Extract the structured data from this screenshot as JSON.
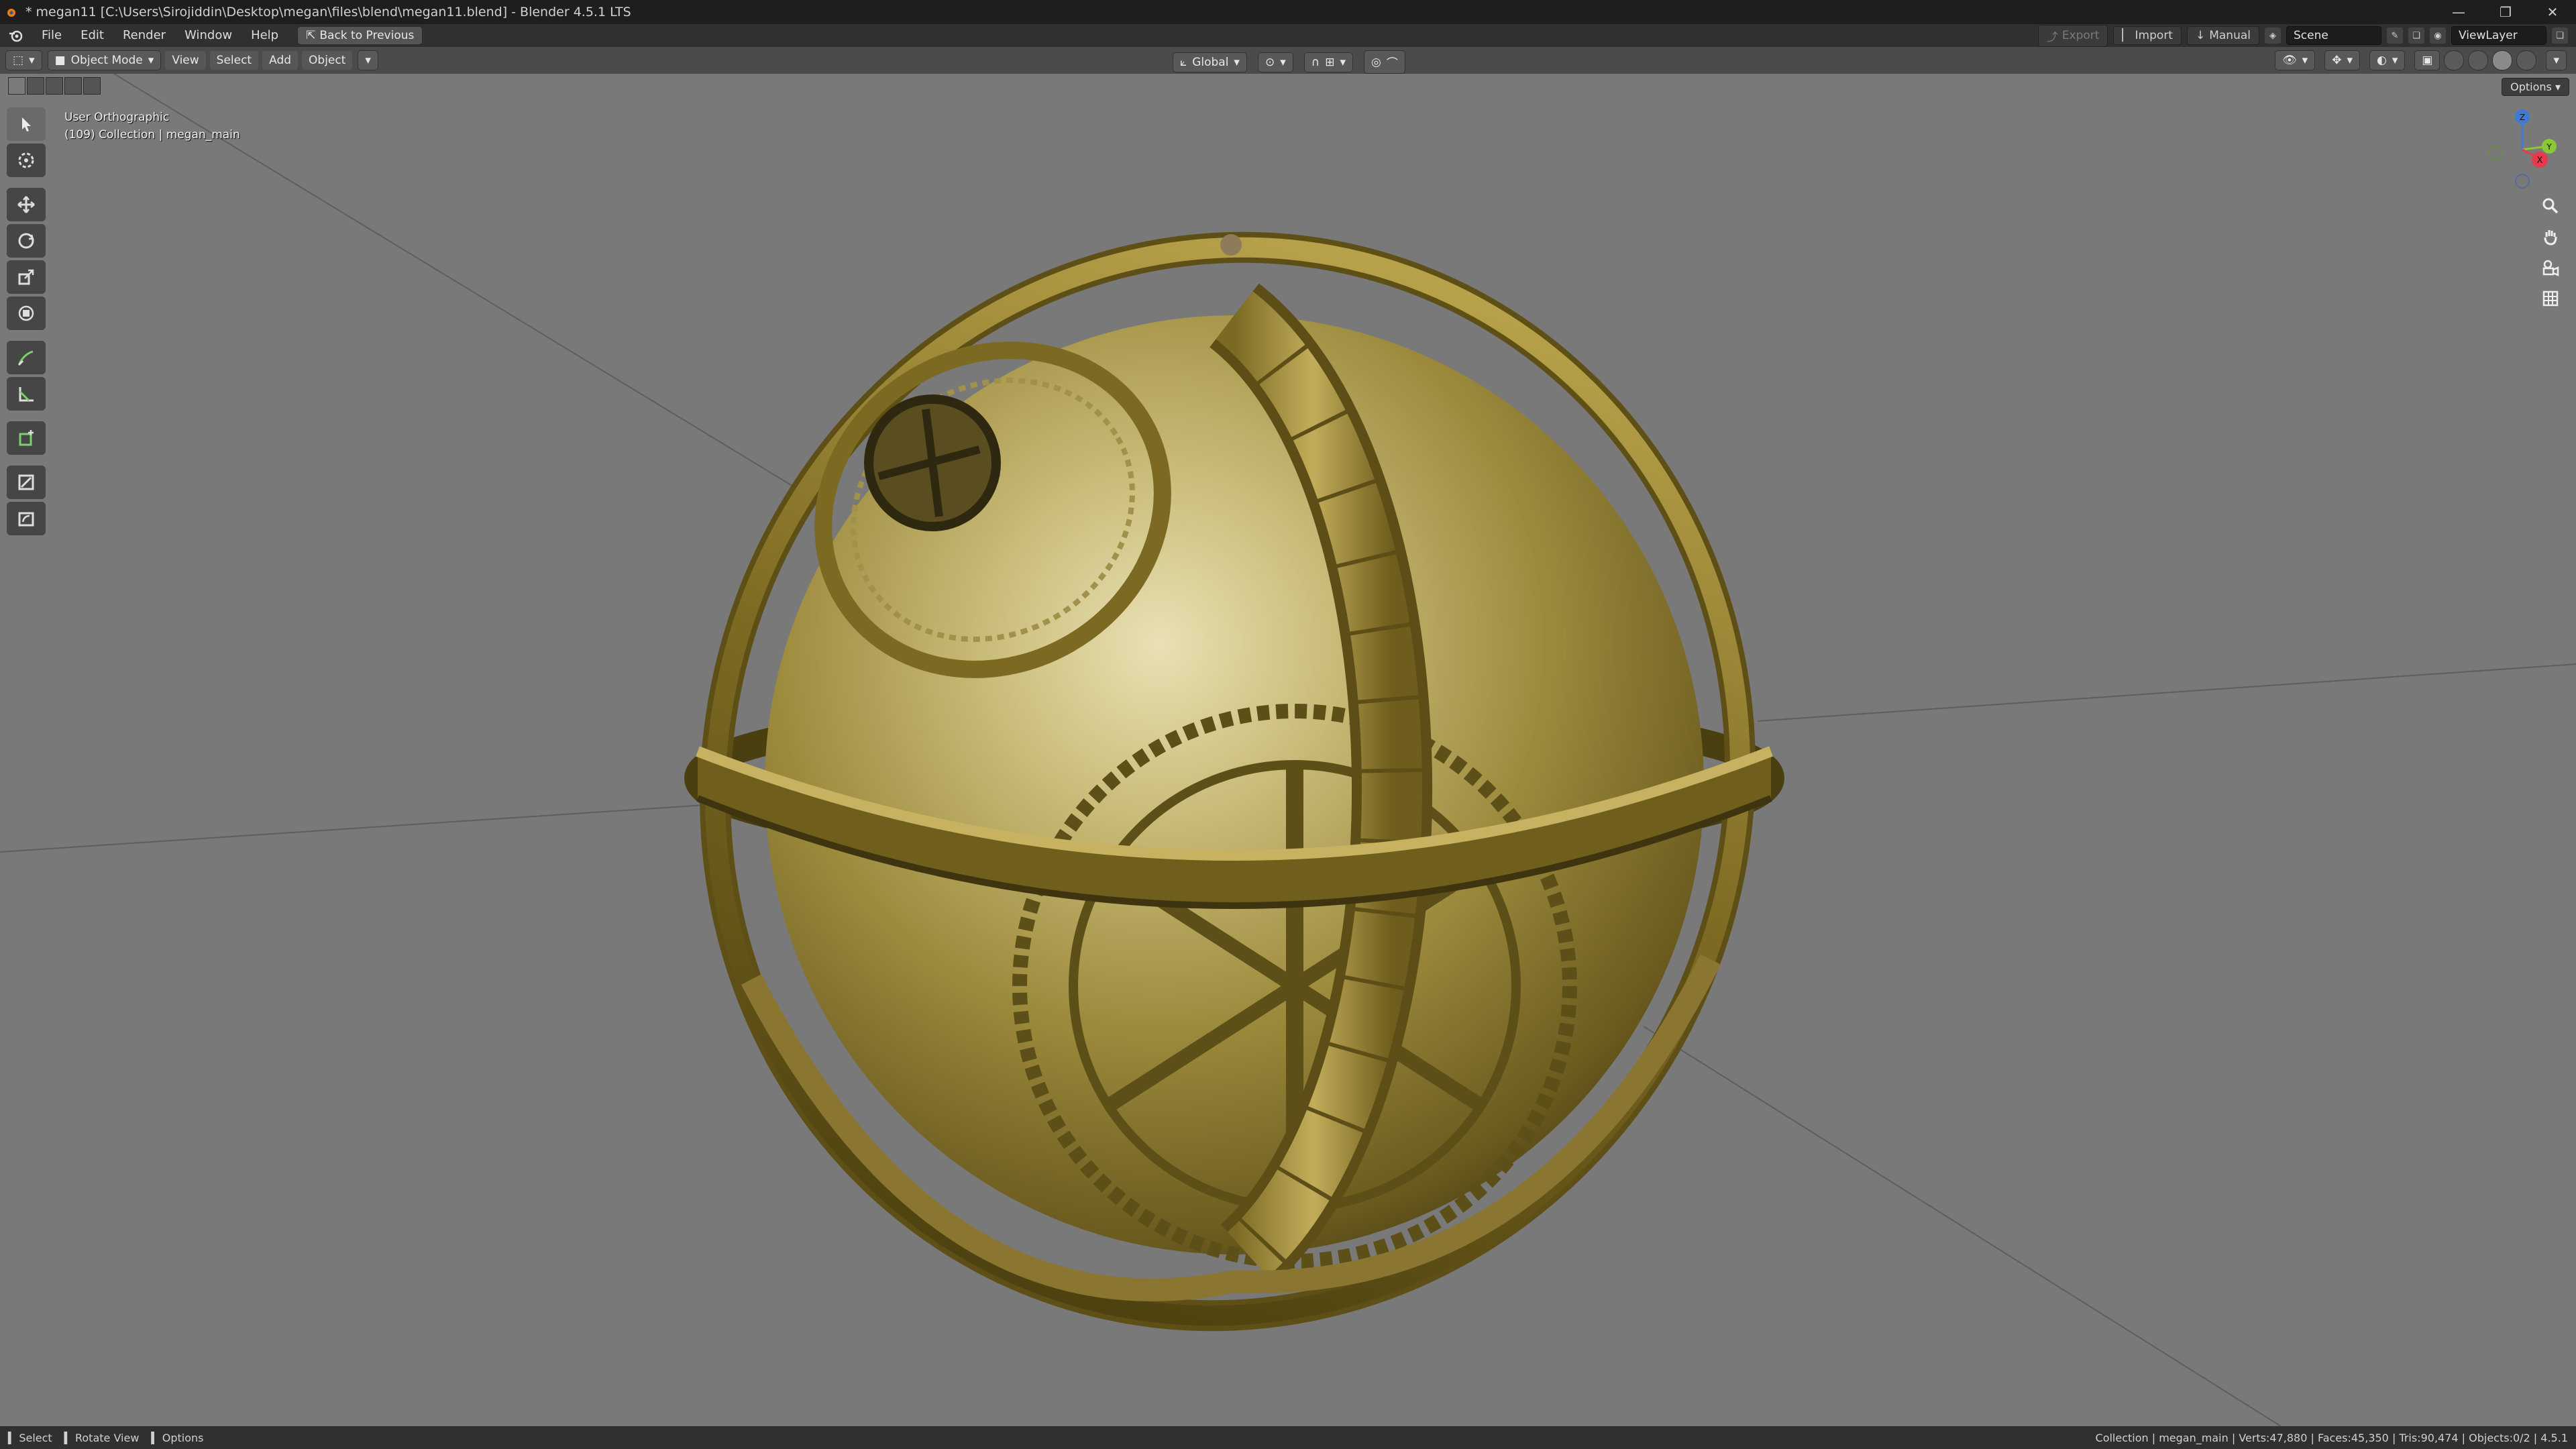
{
  "window": {
    "title": "* megan11 [C:\\Users\\Sirojiddin\\Desktop\\megan\\files\\blend\\megan11.blend] - Blender 4.5.1 LTS",
    "controls": [
      "—",
      "❐",
      "✕"
    ]
  },
  "menubar": {
    "items": [
      "File",
      "Edit",
      "Render",
      "Window",
      "Help"
    ],
    "back_button": "Back to Previous",
    "export": "Export",
    "import": "Import",
    "manual": "Manual",
    "scene": "Scene",
    "view_layer": "ViewLayer"
  },
  "header": {
    "mode": "Object Mode",
    "menus": [
      "View",
      "Select",
      "Add",
      "Object"
    ],
    "transform_orientation": "Global",
    "options": "Options"
  },
  "viewport": {
    "view_name": "User Orthographic",
    "collection_info": "(109) Collection | megan_main",
    "axes": [
      "X",
      "Y",
      "Z"
    ]
  },
  "statusbar": {
    "select": "Select",
    "rotate": "Rotate View",
    "options": "Options",
    "stats": "Collection | megan_main | Verts:47,880 | Faces:45,350 | Tris:90,474 | Objects:0/2 | 4.5.1"
  },
  "colors": {
    "viewport_bg": "#797979",
    "header_bg": "#4b4b4b",
    "brass": "#8f7a2e",
    "axis_x": "#e53b4d",
    "axis_y": "#8ac935",
    "axis_z": "#3f7bd6"
  }
}
